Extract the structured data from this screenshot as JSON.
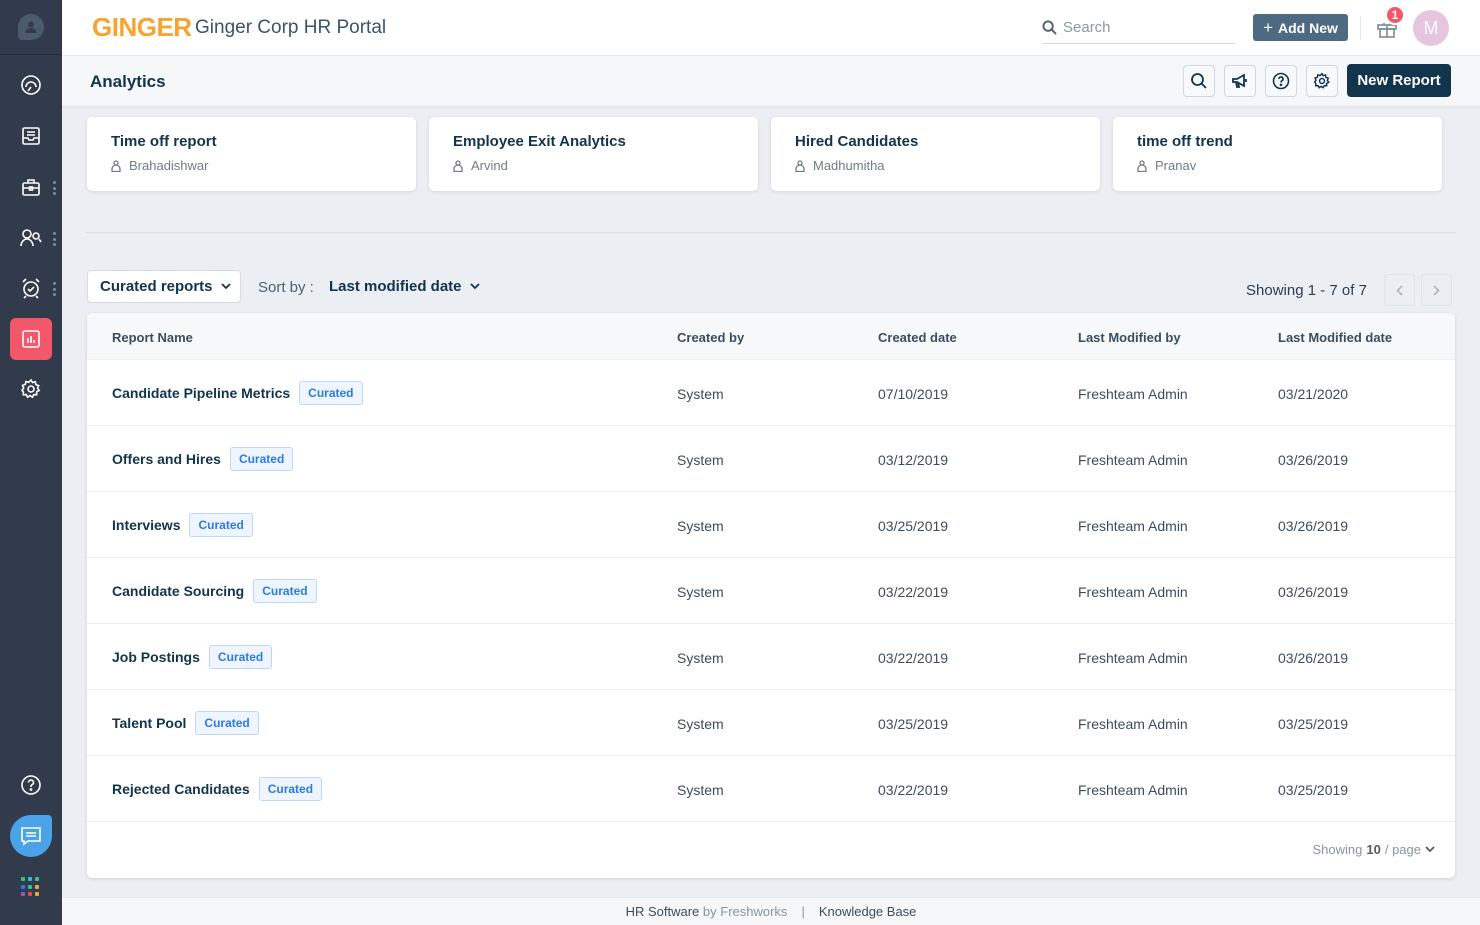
{
  "app": {
    "brand": "GINGER",
    "portal_title": "Ginger Corp HR Portal"
  },
  "header": {
    "search_placeholder": "Search",
    "add_new_label": "Add New",
    "notification_count": "1",
    "avatar_initial": "M"
  },
  "sidebar": {
    "items": [
      {
        "icon": "dashboard-gauge-icon",
        "active": false,
        "has_menu": false
      },
      {
        "icon": "inbox-icon",
        "active": false,
        "has_menu": false
      },
      {
        "icon": "briefcase-icon",
        "active": false,
        "has_menu": true
      },
      {
        "icon": "people-icon",
        "active": false,
        "has_menu": true
      },
      {
        "icon": "alarm-clock-check-icon",
        "active": false,
        "has_menu": true
      },
      {
        "icon": "analytics-chart-icon",
        "active": true,
        "has_menu": false
      },
      {
        "icon": "gear-icon",
        "active": false,
        "has_menu": false
      }
    ],
    "bottom": [
      "help-icon",
      "chat-icon",
      "apps-grid-icon"
    ]
  },
  "subheader": {
    "title": "Analytics",
    "new_report_label": "New Report"
  },
  "recent_reports": [
    {
      "title": "Time off report",
      "owner": "Brahadishwar"
    },
    {
      "title": "Employee Exit Analytics",
      "owner": "Arvind"
    },
    {
      "title": "Hired Candidates",
      "owner": "Madhumitha"
    },
    {
      "title": "time off trend",
      "owner": "Pranav"
    }
  ],
  "filters": {
    "report_type": "Curated reports",
    "sort_by_label": "Sort by :",
    "sort_by_value": "Last modified date",
    "showing": "Showing 1 - 7 of 7"
  },
  "table": {
    "columns": [
      "Report Name",
      "Created by",
      "Created date",
      "Last Modified by",
      "Last Modified date"
    ],
    "rows": [
      {
        "name": "Candidate Pipeline Metrics",
        "badge": "Curated",
        "created_by": "System",
        "created_date": "07/10/2019",
        "modified_by": "Freshteam Admin",
        "modified_date": "03/21/2020"
      },
      {
        "name": "Offers and Hires",
        "badge": "Curated",
        "created_by": "System",
        "created_date": "03/12/2019",
        "modified_by": "Freshteam Admin",
        "modified_date": "03/26/2019"
      },
      {
        "name": "Interviews",
        "badge": "Curated",
        "created_by": "System",
        "created_date": "03/25/2019",
        "modified_by": "Freshteam Admin",
        "modified_date": "03/26/2019"
      },
      {
        "name": "Candidate Sourcing",
        "badge": "Curated",
        "created_by": "System",
        "created_date": "03/22/2019",
        "modified_by": "Freshteam Admin",
        "modified_date": "03/26/2019"
      },
      {
        "name": "Job Postings",
        "badge": "Curated",
        "created_by": "System",
        "created_date": "03/22/2019",
        "modified_by": "Freshteam Admin",
        "modified_date": "03/26/2019"
      },
      {
        "name": "Talent Pool",
        "badge": "Curated",
        "created_by": "System",
        "created_date": "03/25/2019",
        "modified_by": "Freshteam Admin",
        "modified_date": "03/25/2019"
      },
      {
        "name": "Rejected Candidates",
        "badge": "Curated",
        "created_by": "System",
        "created_date": "03/22/2019",
        "modified_by": "Freshteam Admin",
        "modified_date": "03/25/2019"
      }
    ],
    "per_page_prefix": "Showing",
    "per_page_value": "10",
    "per_page_suffix": "/ page"
  },
  "footer": {
    "product": "HR Software",
    "by": "by Freshworks",
    "separator": "|",
    "link": "Knowledge Base"
  },
  "colors": {
    "sidebar_bg": "#313b4c",
    "active_nav": "#f2576a",
    "brand_orange": "#f6a431",
    "primary_dark": "#12344d",
    "badge_blue": "#2c7be5",
    "chat_blue": "#4aa3e8"
  }
}
